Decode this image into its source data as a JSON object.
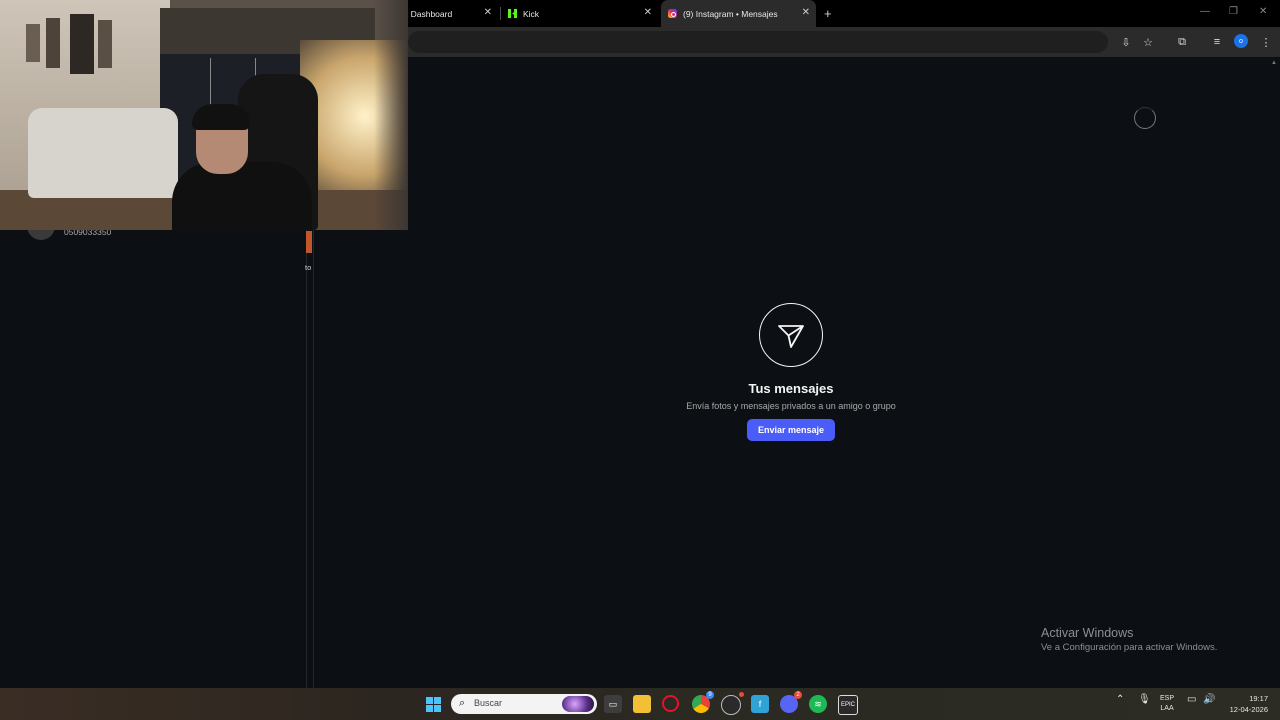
{
  "browser": {
    "tabs": [
      {
        "label": "k Dashboard",
        "active": false
      },
      {
        "label": "Kick",
        "active": false
      },
      {
        "label": "(9) Instagram • Mensajes",
        "active": true
      }
    ],
    "new_tab": "+",
    "close_glyph": "✕",
    "profile_initial": "o"
  },
  "instagram": {
    "contact_phone": "0509033350",
    "edge_text": "to",
    "empty_state": {
      "title": "Tus mensajes",
      "subtitle": "Envía fotos y mensajes privados a un amigo o grupo",
      "button": "Enviar mensaje",
      "icon": "paper-plane-icon"
    }
  },
  "watermark": {
    "line1": "Activar Windows",
    "line2": "Ve a Configuración para activar Windows."
  },
  "taskbar": {
    "search_placeholder": "Buscar",
    "apps": [
      "file-explorer-icon",
      "opera-icon",
      "chrome-icon",
      "obs-icon",
      "freshpaint-icon",
      "discord-icon",
      "spotify-icon",
      "epic-games-icon"
    ],
    "chrome_badge": "9",
    "discord_badge": "2",
    "language": "ESP",
    "layout": "LAA",
    "time": "19:17",
    "date": "12-04-2026"
  },
  "colors": {
    "page_bg": "#0c1014",
    "button_blue": "#4a5df9",
    "kick_green": "#53fc18"
  }
}
